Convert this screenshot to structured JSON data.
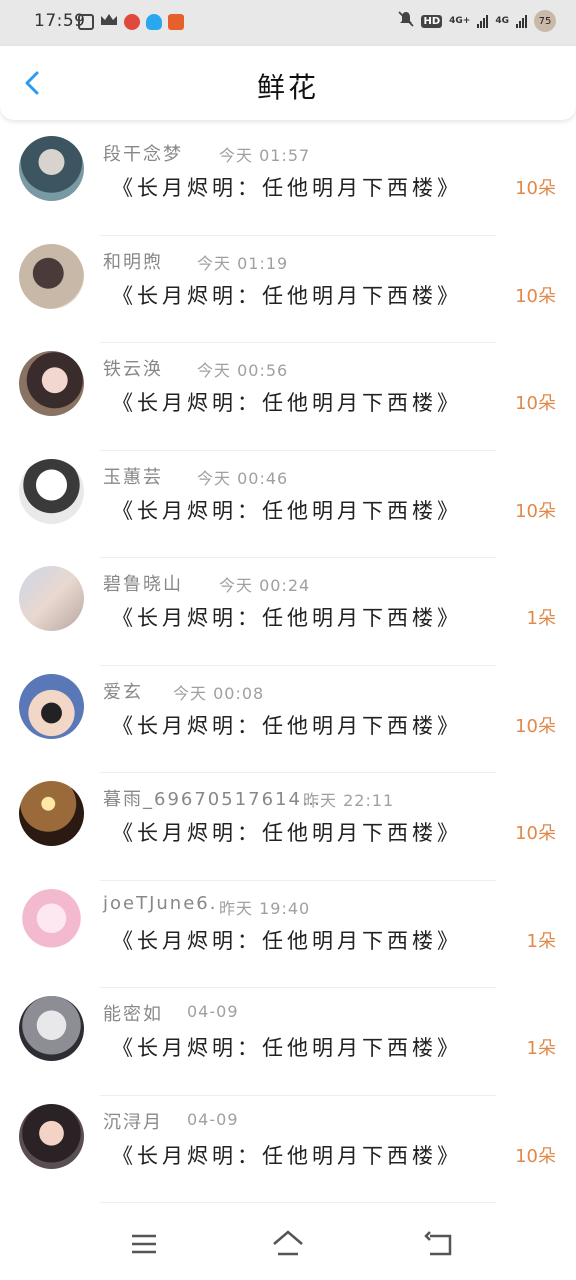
{
  "status_bar": {
    "time": "17:59",
    "network1": "4G+",
    "network2": "4G",
    "battery": "75"
  },
  "header": {
    "title": "鲜花"
  },
  "colors": {
    "accent_blue": "#2b9af3",
    "count_orange": "#e0894a"
  },
  "rows": [
    {
      "name": "段干念梦",
      "time": "今天 01:57",
      "book": "《长月烬明：任他明月下西楼》",
      "count": "10朵"
    },
    {
      "name": "和明煦",
      "time": "今天 01:19",
      "book": "《长月烬明：任他明月下西楼》",
      "count": "10朵"
    },
    {
      "name": "铁云涣",
      "time": "今天 00:56",
      "book": "《长月烬明：任他明月下西楼》",
      "count": "10朵"
    },
    {
      "name": "玉蕙芸",
      "time": "今天 00:46",
      "book": "《长月烬明：任他明月下西楼》",
      "count": "10朵"
    },
    {
      "name": "碧鲁晓山",
      "time": "今天 00:24",
      "book": "《长月烬明：任他明月下西楼》",
      "count": "1朵"
    },
    {
      "name": "爱玄",
      "time": "今天 00:08",
      "book": "《长月烬明：任他明月下西楼》",
      "count": "10朵"
    },
    {
      "name": "暮雨_69670517614…",
      "time": "昨天 22:11",
      "book": "《长月烬明：任他明月下西楼》",
      "count": "10朵"
    },
    {
      "name": "joeTJune6.",
      "time": "昨天 19:40",
      "book": "《长月烬明：任他明月下西楼》",
      "count": "1朵"
    },
    {
      "name": "能密如",
      "time": "04-09",
      "book": "《长月烬明：任他明月下西楼》",
      "count": "1朵"
    },
    {
      "name": "沉浔月",
      "time": "04-09",
      "book": "《长月烬明：任他明月下西楼》",
      "count": "10朵"
    }
  ]
}
